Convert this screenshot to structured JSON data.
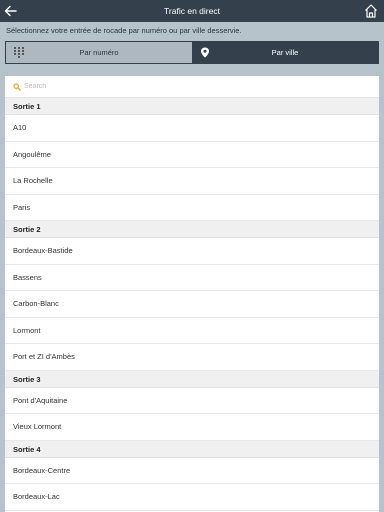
{
  "header": {
    "title": "Trafic en direct"
  },
  "instruction": "Sélectionnez votre entrée de rocade par numéro ou par ville desservie.",
  "tabs": {
    "by_number": "Par numéro",
    "by_city": "Par ville"
  },
  "search": {
    "placeholder": "Search"
  },
  "sections": [
    {
      "title": "Sortie 1",
      "items": [
        "A10",
        "Angoulême",
        "La Rochelle",
        "Paris"
      ]
    },
    {
      "title": "Sortie 2",
      "items": [
        "Bordeaux-Bastide",
        "Bassens",
        "Carbon-Blanc",
        "Lormont",
        "Port et ZI d'Ambès"
      ]
    },
    {
      "title": "Sortie 3",
      "items": [
        "Pont d'Aquitaine",
        "Vieux Lormont"
      ]
    },
    {
      "title": "Sortie 4",
      "items": [
        "Bordeaux-Centre",
        "Bordeaux-Lac"
      ]
    }
  ],
  "colors": {
    "header_bg": "#34414c",
    "page_bg": "#b7c3cb",
    "search_icon": "#f0a020"
  }
}
